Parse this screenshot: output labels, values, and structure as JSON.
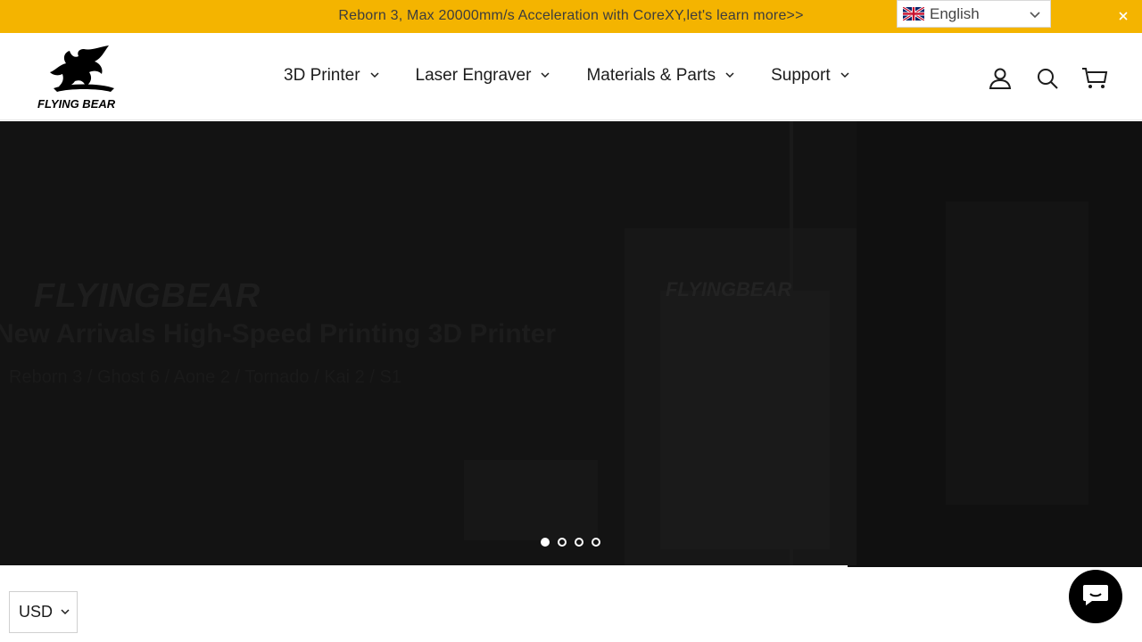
{
  "announcement": {
    "text": "Reborn 3, Max 20000mm/s Acceleration with CoreXY,let's learn more>>",
    "background": "#f4b400"
  },
  "language": {
    "selected": "English",
    "flag_icon": "uk-flag-icon"
  },
  "header": {
    "logo_text": "FLYING BEAR",
    "nav": [
      {
        "label": "3D Printer"
      },
      {
        "label": "Laser Engraver"
      },
      {
        "label": "Materials & Parts"
      },
      {
        "label": "Support"
      }
    ],
    "icons": [
      "account-icon",
      "search-icon",
      "cart-icon"
    ]
  },
  "hero": {
    "brand": "FLYINGBEAR",
    "title": "New Arrivals High-Speed Printing 3D Printer",
    "subtitle": "Reborn 3 / Ghost 6 / Aone 2 / Tornado / Kai 2 / S1",
    "product_brand": "FLYINGBEAR",
    "slides": 4,
    "active_slide": 1
  },
  "currency": {
    "selected": "USD"
  },
  "chat": {
    "icon": "chat-icon"
  }
}
